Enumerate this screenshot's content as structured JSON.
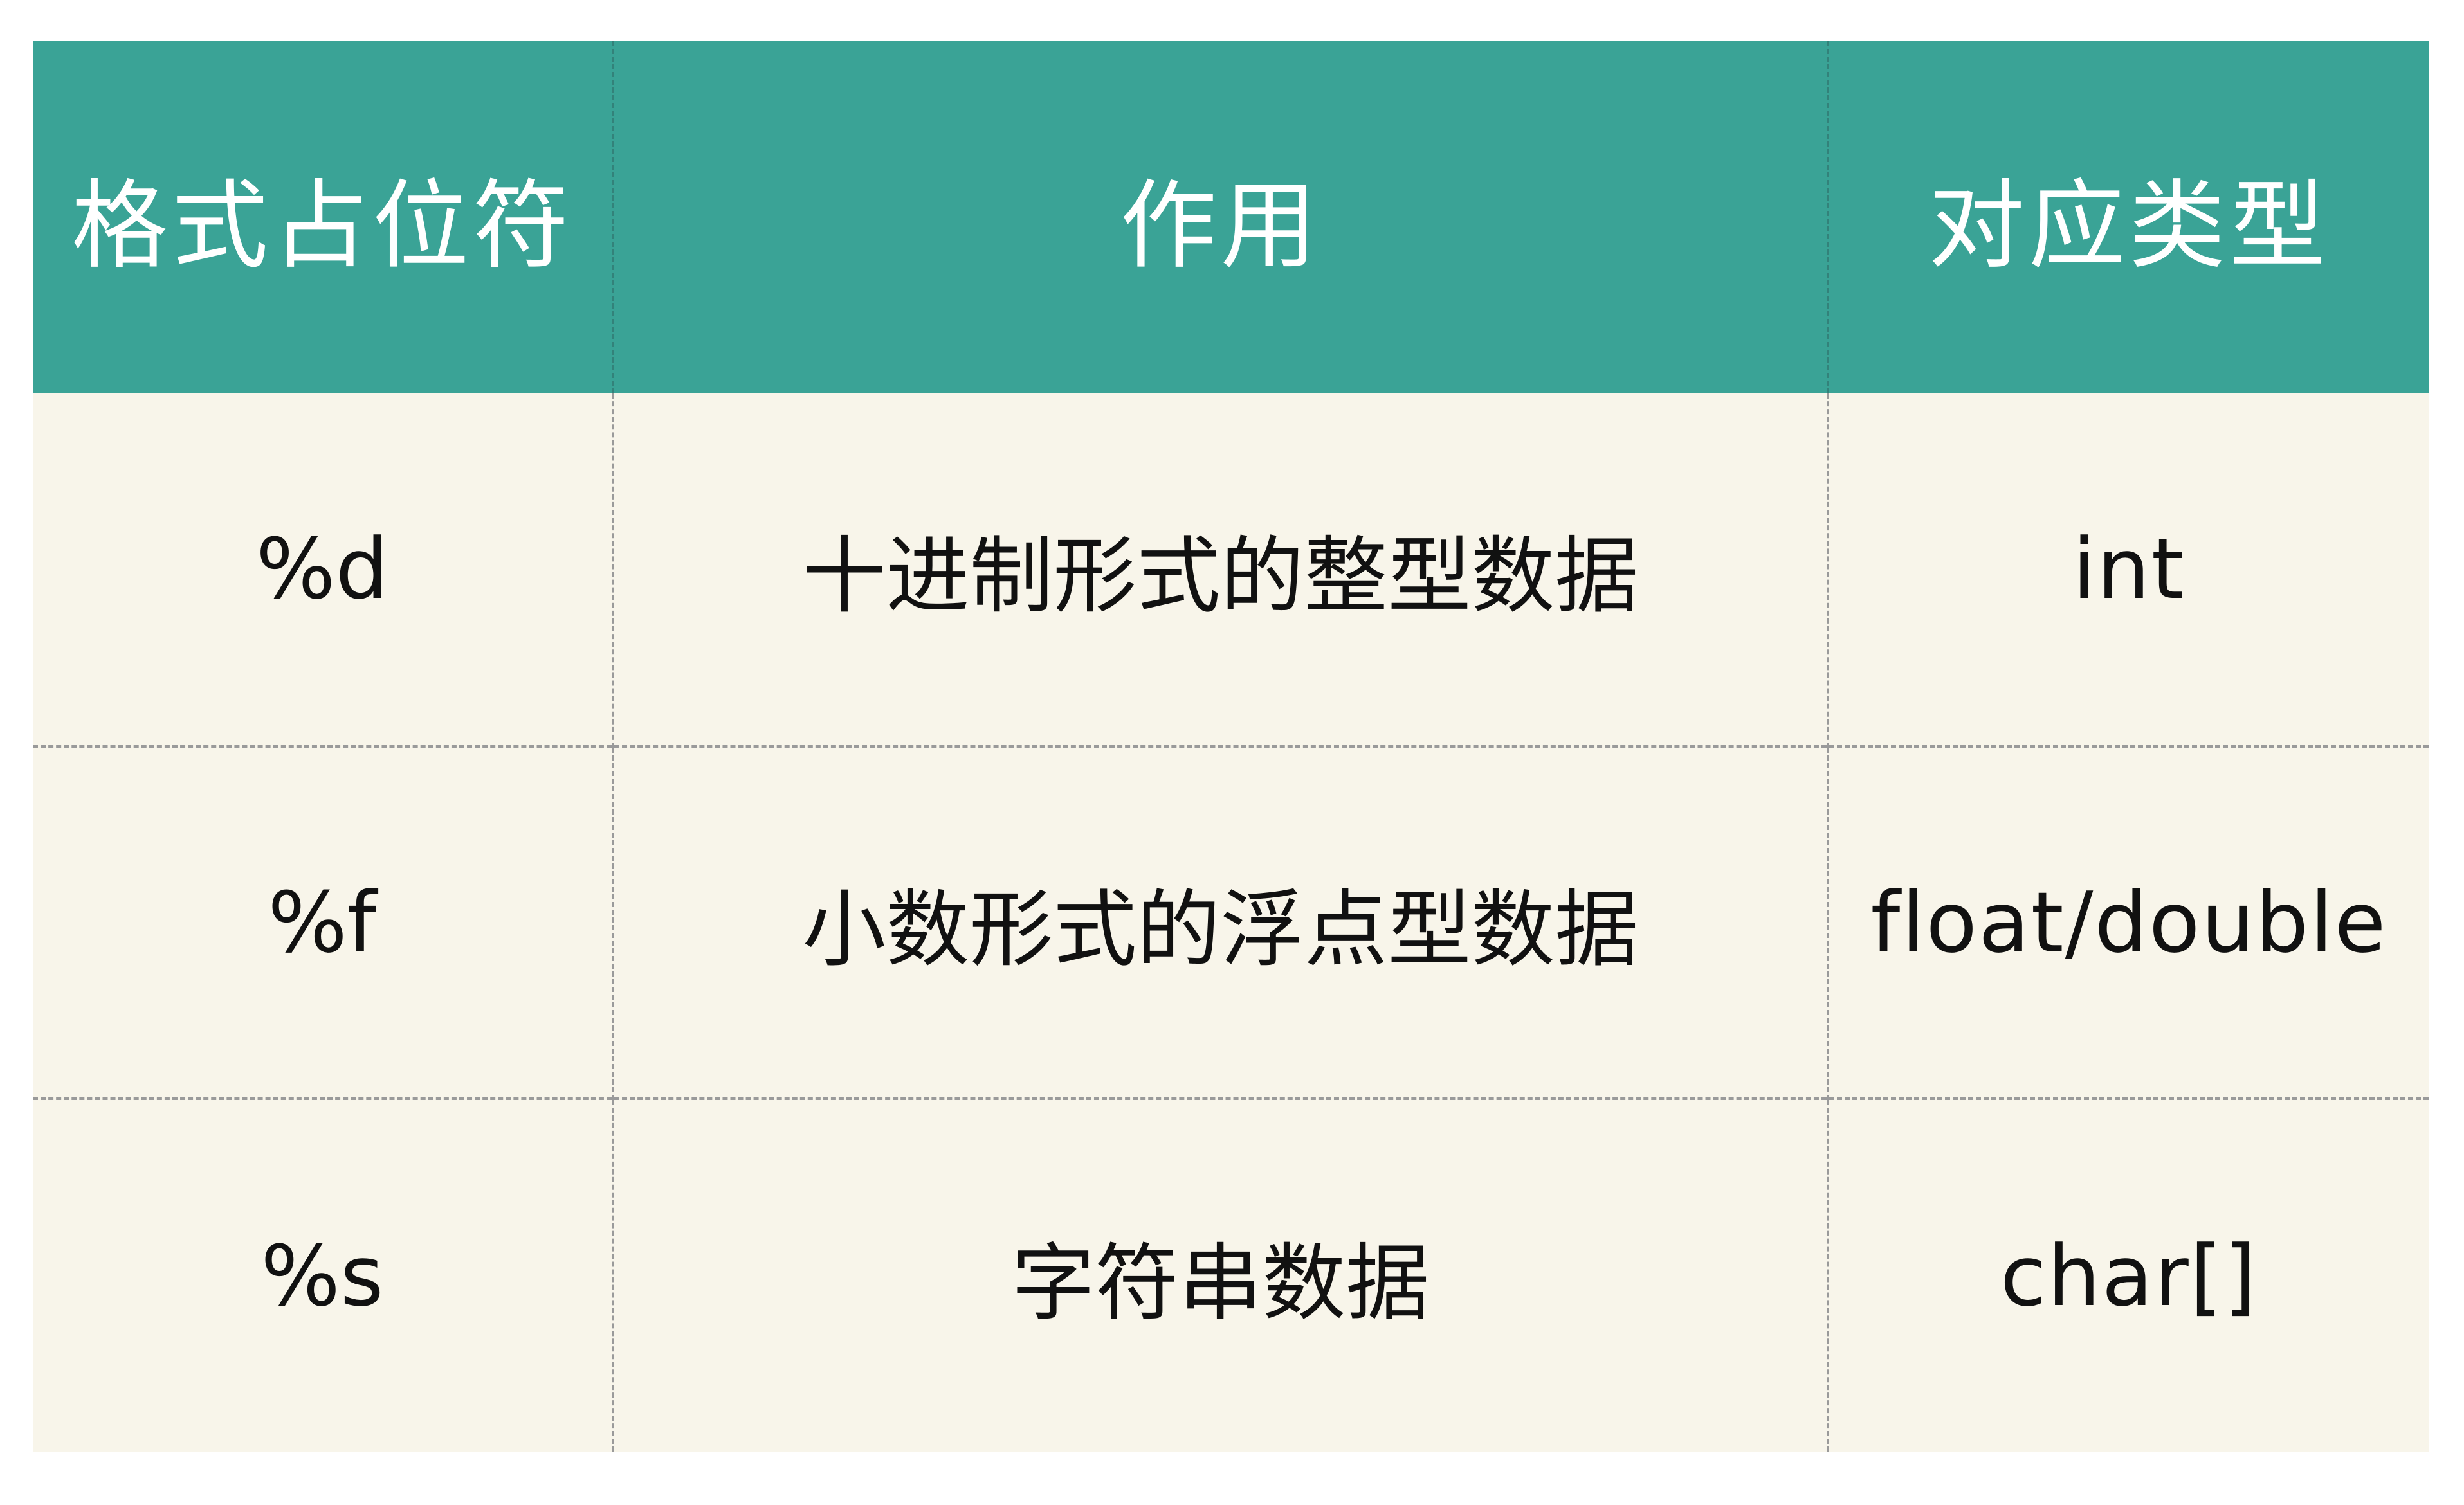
{
  "table": {
    "headers": [
      "格式占位符",
      "作用",
      "对应类型"
    ],
    "rows": [
      {
        "placeholder": "%d",
        "purpose": "十进制形式的整型数据",
        "type": "int"
      },
      {
        "placeholder": "%f",
        "purpose": "小数形式的浮点型数据",
        "type": "float/double"
      },
      {
        "placeholder": "%s",
        "purpose": "字符串数据",
        "type": "char[]"
      }
    ]
  },
  "colors": {
    "header_bg": "#3aa396",
    "header_text": "#ffffff",
    "body_bg": "#f8f5ea",
    "body_text": "#111111",
    "divider": "#9a9a9a"
  }
}
